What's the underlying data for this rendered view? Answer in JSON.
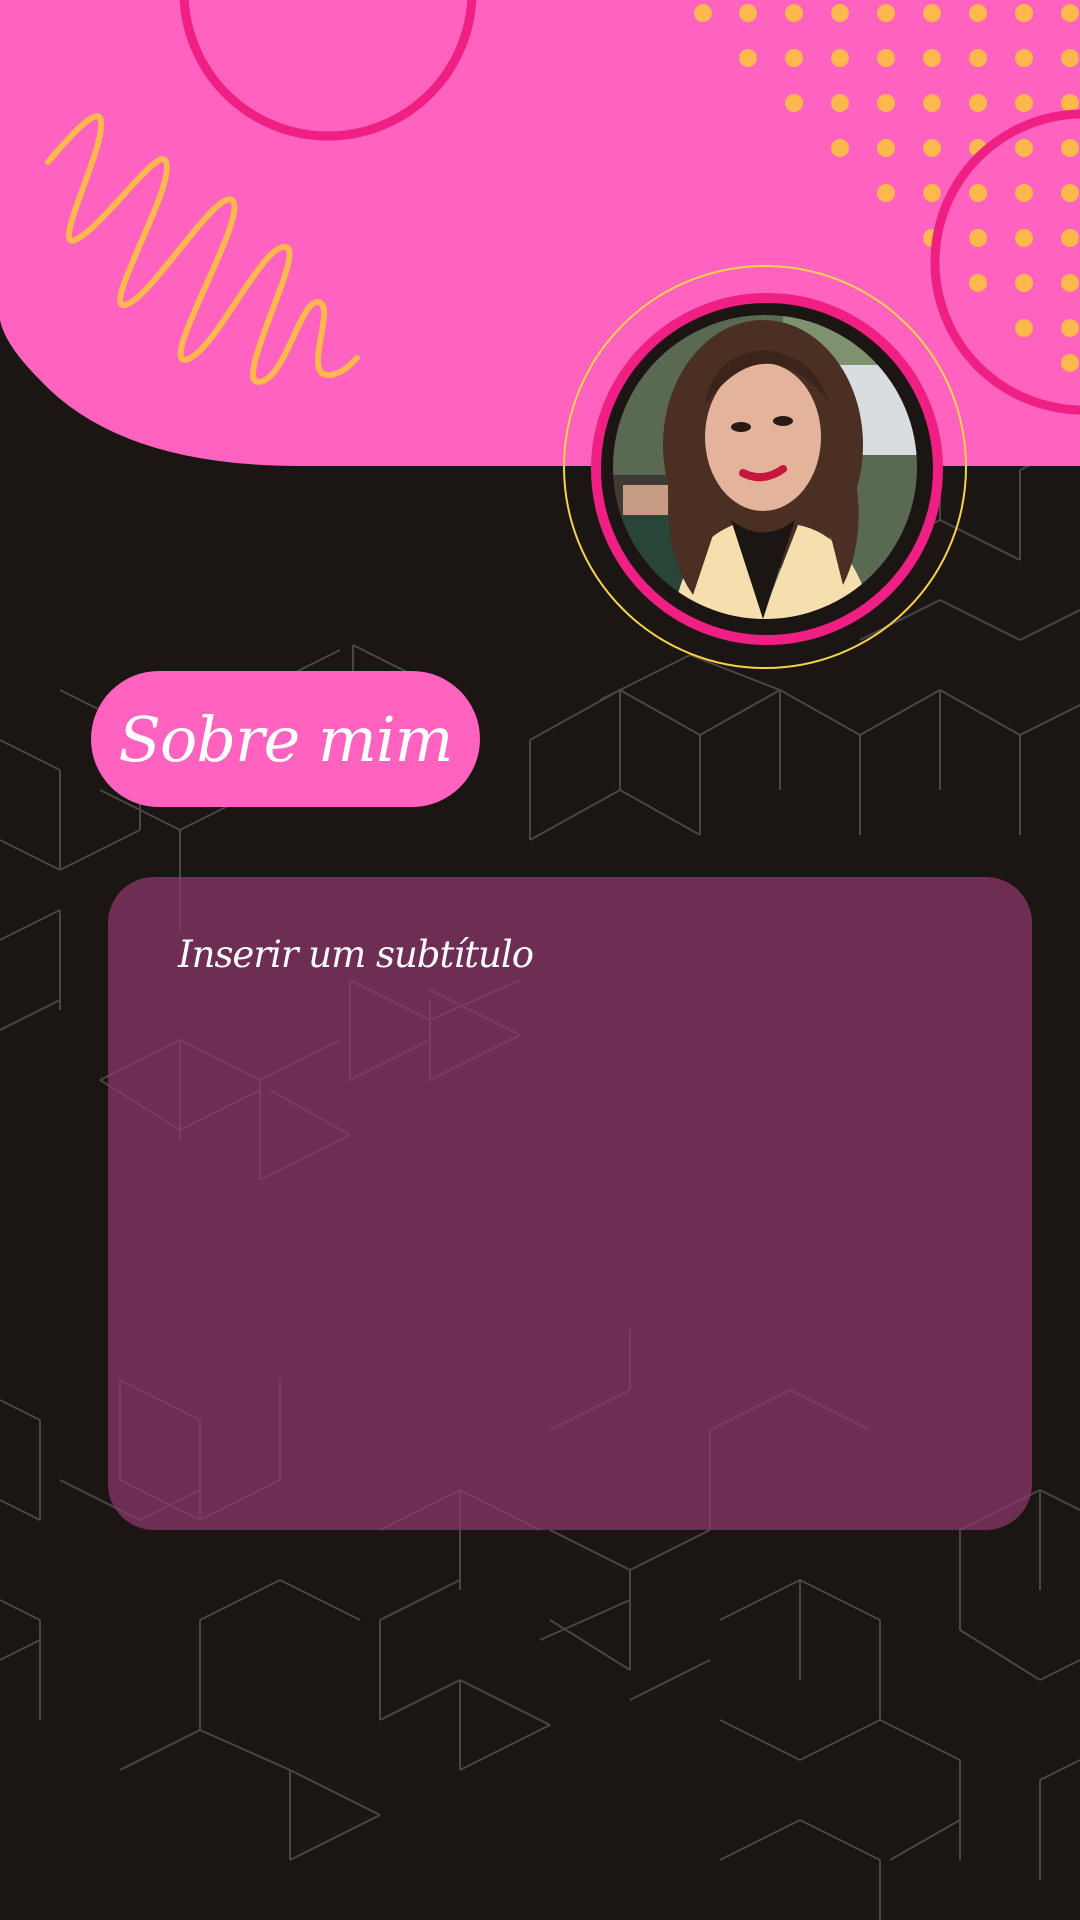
{
  "colors": {
    "background": "#1b1514",
    "pink": "#ff62bf",
    "magenta": "#ef1f83",
    "orange_dots": "#ffb84d",
    "gold_ring": "#f4d34a",
    "card": "#8f376c"
  },
  "icons": [
    "squiggle-decoration",
    "dot-grid-decoration",
    "circle-outline-decoration",
    "geometric-pattern"
  ],
  "section": {
    "title": "Sobre mim",
    "subtitle": "Inserir um subtítulo"
  }
}
